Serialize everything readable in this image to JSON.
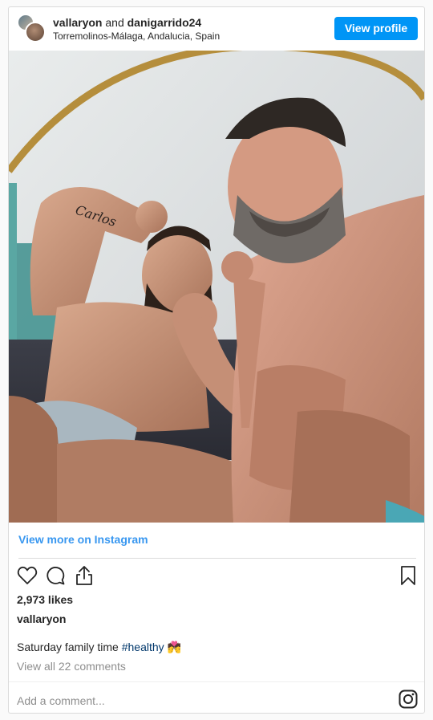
{
  "header": {
    "user1": "vallaryon",
    "connector": "and",
    "user2": "danigarrido24",
    "location": "Torremolinos-Málaga, Andalucia, Spain",
    "view_profile_label": "View profile"
  },
  "photo": {
    "tattoo_text": "Carlos"
  },
  "footer": {
    "view_more_label": "View more on Instagram",
    "likes": "2,973 likes",
    "username": "vallaryon",
    "caption_text": "Saturday family time ",
    "hashtag": "#healthy",
    "emoji": "💏",
    "view_comments": "View all 22 comments",
    "add_comment_placeholder": "Add a comment..."
  },
  "icons": {
    "like": "heart-icon",
    "comment": "comment-icon",
    "share": "share-icon",
    "save": "bookmark-icon",
    "brand": "instagram-icon"
  },
  "colors": {
    "accent": "#0095f6",
    "link": "#3897f0",
    "hashtag": "#00376b"
  }
}
